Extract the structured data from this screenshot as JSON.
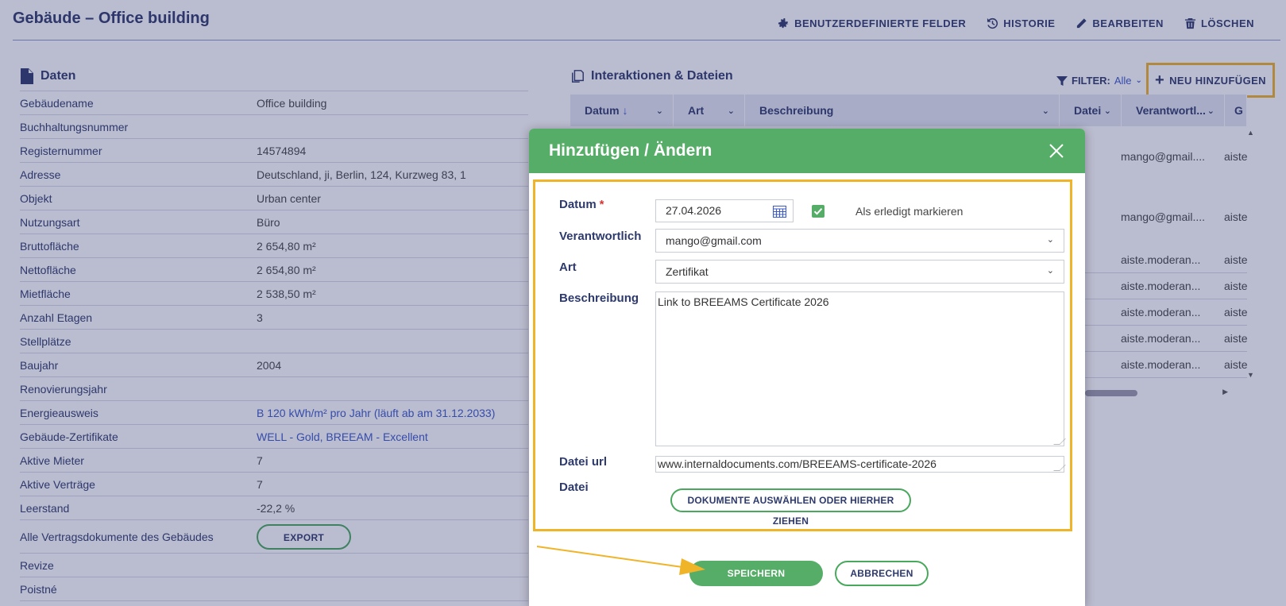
{
  "header": {
    "title": "Gebäude – Office building",
    "actions": {
      "custom_fields": "BENUTZERDEFINIERTE FELDER",
      "history": "HISTORIE",
      "edit": "BEARBEITEN",
      "delete": "LÖSCHEN"
    }
  },
  "left": {
    "title": "Daten",
    "rows": [
      {
        "label": "Gebäudename",
        "value": "Office building"
      },
      {
        "label": "Buchhaltungsnummer",
        "value": ""
      },
      {
        "label": "Registernummer",
        "value": "14574894"
      },
      {
        "label": "Adresse",
        "value": "Deutschland, ji, Berlin, 124, Kurzweg 83, 1"
      },
      {
        "label": "Objekt",
        "value": "Urban center"
      },
      {
        "label": "Nutzungsart",
        "value": "Büro"
      },
      {
        "label": "Bruttofläche",
        "value": "2 654,80 m²"
      },
      {
        "label": "Nettofläche",
        "value": "2 654,80 m²"
      },
      {
        "label": "Mietfläche",
        "value": "2 538,50 m²"
      },
      {
        "label": "Anzahl Etagen",
        "value": "3"
      },
      {
        "label": "Stellplätze",
        "value": ""
      },
      {
        "label": "Baujahr",
        "value": "2004"
      },
      {
        "label": "Renovierungsjahr",
        "value": ""
      },
      {
        "label": "Energieausweis",
        "value": "B 120 kWh/m² pro Jahr (läuft ab am 31.12.2033)"
      },
      {
        "label": "Gebäude-Zertifikate",
        "value": "WELL - Gold, BREEAM - Excellent"
      },
      {
        "label": "Aktive Mieter",
        "value": "7"
      },
      {
        "label": "Aktive Verträge",
        "value": "7"
      },
      {
        "label": "Leerstand",
        "value": "-22,2 %"
      },
      {
        "label": "Alle Vertragsdokumente des Gebäudes",
        "value": "EXPORT"
      },
      {
        "label": "Revize",
        "value": ""
      },
      {
        "label": "Poistné",
        "value": ""
      }
    ]
  },
  "right": {
    "title": "Interaktionen & Dateien",
    "filter_label": "FILTER:",
    "filter_value": "Alle",
    "new_label": "NEU HINZUFÜGEN",
    "columns": [
      "Datum",
      "Art",
      "Beschreibung",
      "Datei",
      "Verantwortl...",
      "G"
    ],
    "rows": [
      {
        "user": "mango@gmail....",
        "last": "aiste"
      },
      {
        "user": "mango@gmail....",
        "last": "aiste"
      },
      {
        "user": "aiste.moderan...",
        "last": "aiste"
      },
      {
        "user": "aiste.moderan...",
        "last": "aiste"
      },
      {
        "user": "aiste.moderan...",
        "last": "aiste"
      },
      {
        "user": "aiste.moderan...",
        "last": "aiste"
      },
      {
        "user": "aiste.moderan...",
        "last": "aiste"
      }
    ]
  },
  "modal": {
    "title": "Hinzufügen / Ändern",
    "date_label": "Datum",
    "date_value": "27.04.2026",
    "done_label": "Als erledigt markieren",
    "responsible_label": "Verantwortlich",
    "responsible_value": "mango@gmail.com",
    "type_label": "Art",
    "type_value": "Zertifikat",
    "description_label": "Beschreibung",
    "description_value": "Link to BREEAMS Certificate 2026",
    "url_label": "Datei url",
    "url_value": "www.internaldocuments.com/BREEAMS-certificate-2026",
    "file_label": "Datei",
    "file_button": "DOKUMENTE AUSWÄHLEN ODER HIERHER ZIEHEN",
    "save": "SPEICHERN",
    "cancel": "ABBRECHEN"
  },
  "colors": {
    "brand_navy": "#2d3a6b",
    "accent_green": "#55ad67",
    "highlight_yellow": "#f0b429",
    "link_blue": "#3a58c9"
  }
}
